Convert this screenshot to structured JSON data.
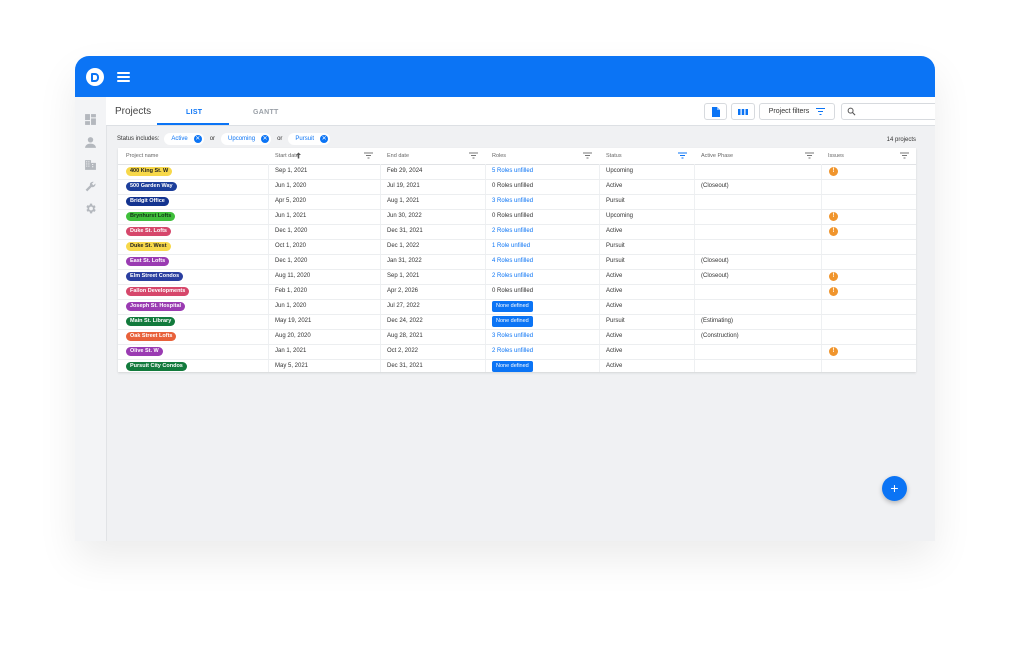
{
  "page": {
    "title": "Projects"
  },
  "tabs": {
    "list": "LIST",
    "gantt": "GANTT"
  },
  "toolbar": {
    "filters_label": "Project filters",
    "search_placeholder": ""
  },
  "status_filter": {
    "label": "Status includes:",
    "chips": [
      "Active",
      "Upcoming",
      "Pursuit"
    ],
    "or": "or",
    "close": "✕"
  },
  "count": "14 projects",
  "columns": [
    "Project name",
    "Start date",
    "End date",
    "Roles",
    "Status",
    "Active Phase",
    "Issues"
  ],
  "fab": "+",
  "issue_symbol": "!",
  "colors": {
    "brand": "#0b74f5",
    "issue": "#f0952d"
  },
  "rows": [
    {
      "name": "400 King St. W",
      "pill_bg": "#f7d84a",
      "pill_fg": "#222222",
      "start": "Sep 1, 2021",
      "end": "Feb 29, 2024",
      "roles": "5 Roles unfilled",
      "roles_type": "link",
      "status": "Upcoming",
      "phase": "",
      "issue": true
    },
    {
      "name": "500 Garden Way",
      "pill_bg": "#1d3f9b",
      "pill_fg": "#ffffff",
      "start": "Jun 1, 2020",
      "end": "Jul 19, 2021",
      "roles": "0 Roles unfilled",
      "roles_type": "text",
      "status": "Active",
      "phase": "(Closeout)",
      "issue": false
    },
    {
      "name": "Bridgit Office",
      "pill_bg": "#13338f",
      "pill_fg": "#ffffff",
      "start": "Apr 5, 2020",
      "end": "Aug 1, 2021",
      "roles": "3 Roles unfilled",
      "roles_type": "link",
      "status": "Pursuit",
      "phase": "",
      "issue": false
    },
    {
      "name": "Brynhurst Lofts",
      "pill_bg": "#3fbf3b",
      "pill_fg": "#14361a",
      "start": "Jun 1, 2021",
      "end": "Jun 30, 2022",
      "roles": "0 Roles unfilled",
      "roles_type": "text",
      "status": "Upcoming",
      "phase": "",
      "issue": true
    },
    {
      "name": "Duke St. Lofts",
      "pill_bg": "#d6476b",
      "pill_fg": "#ffffff",
      "start": "Dec 1, 2020",
      "end": "Dec 31, 2021",
      "roles": "2 Roles unfilled",
      "roles_type": "link",
      "status": "Active",
      "phase": "",
      "issue": true
    },
    {
      "name": "Duke St. West",
      "pill_bg": "#f7d84a",
      "pill_fg": "#222222",
      "start": "Oct 1, 2020",
      "end": "Dec 1, 2022",
      "roles": "1 Role unfilled",
      "roles_type": "link",
      "status": "Pursuit",
      "phase": "",
      "issue": false
    },
    {
      "name": "East St. Lofts",
      "pill_bg": "#9a3bb2",
      "pill_fg": "#ffffff",
      "start": "Dec 1, 2020",
      "end": "Jan 31, 2022",
      "roles": "4 Roles unfilled",
      "roles_type": "link",
      "status": "Pursuit",
      "phase": "(Closeout)",
      "issue": false
    },
    {
      "name": "Elm Street Condos",
      "pill_bg": "#2a3fa0",
      "pill_fg": "#ffffff",
      "start": "Aug 11, 2020",
      "end": "Sep 1, 2021",
      "roles": "2 Roles unfilled",
      "roles_type": "link",
      "status": "Active",
      "phase": "(Closeout)",
      "issue": true
    },
    {
      "name": "Fallon Developments",
      "pill_bg": "#d6476b",
      "pill_fg": "#ffffff",
      "start": "Feb 1, 2020",
      "end": "Apr 2, 2026",
      "roles": "0 Roles unfilled",
      "roles_type": "text",
      "status": "Active",
      "phase": "",
      "issue": true
    },
    {
      "name": "Joseph St. Hospital",
      "pill_bg": "#9a3bb2",
      "pill_fg": "#ffffff",
      "start": "Jun 1, 2020",
      "end": "Jul 27, 2022",
      "roles": "None defined",
      "roles_type": "badge",
      "status": "Active",
      "phase": "",
      "issue": false
    },
    {
      "name": "Main St. Library",
      "pill_bg": "#127a3c",
      "pill_fg": "#ffffff",
      "start": "May 19, 2021",
      "end": "Dec 24, 2022",
      "roles": "None defined",
      "roles_type": "badge",
      "status": "Pursuit",
      "phase": "(Estimating)",
      "issue": false
    },
    {
      "name": "Oak Street Lofts",
      "pill_bg": "#e8613a",
      "pill_fg": "#ffffff",
      "start": "Aug 20, 2020",
      "end": "Aug 28, 2021",
      "roles": "3 Roles unfilled",
      "roles_type": "link",
      "status": "Active",
      "phase": "(Construction)",
      "issue": false
    },
    {
      "name": "Olive St. W",
      "pill_bg": "#9a3bb2",
      "pill_fg": "#ffffff",
      "start": "Jan 1, 2021",
      "end": "Oct 2, 2022",
      "roles": "2 Roles unfilled",
      "roles_type": "link",
      "status": "Active",
      "phase": "",
      "issue": true
    },
    {
      "name": "Pursuit City Condos",
      "pill_bg": "#127a3c",
      "pill_fg": "#ffffff",
      "start": "May 5, 2021",
      "end": "Dec 31, 2021",
      "roles": "None defined",
      "roles_type": "badge",
      "status": "Active",
      "phase": "",
      "issue": false
    }
  ]
}
